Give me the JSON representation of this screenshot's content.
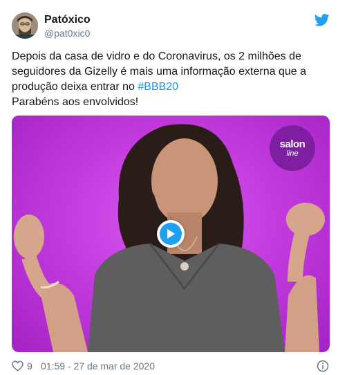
{
  "author": {
    "name": "Patóxico",
    "handle": "@pat0xic0"
  },
  "tweet": {
    "line1": "Depois da casa de vidro e do Coronavirus, os 2 milhões de seguidores da Gizelly é mais uma informação externa que a produção deixa entrar no ",
    "hashtag": "#BBB20",
    "line2": "Parabéns aos envolvidos!"
  },
  "media": {
    "logo_line1": "salon",
    "logo_line2": "line"
  },
  "footer": {
    "likes": "9",
    "timestamp": "01:59 - 27 de mar de 2020"
  },
  "colors": {
    "link": "#1b95e0",
    "twitter_blue": "#1da1f2",
    "background_purple": "#c43ce0"
  },
  "icons": [
    "twitter-bird-icon",
    "play-icon",
    "heart-icon",
    "info-icon"
  ]
}
